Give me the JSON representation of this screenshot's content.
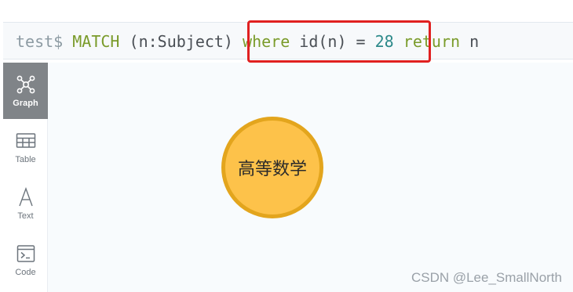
{
  "query": {
    "prompt": "test$",
    "tokens": [
      {
        "text": "MATCH",
        "kind": "keyword"
      },
      {
        "text": " (n:Subject) ",
        "kind": "plain"
      },
      {
        "text": "where",
        "kind": "keyword"
      },
      {
        "text": " id(n) ",
        "kind": "plain"
      },
      {
        "text": "=",
        "kind": "op"
      },
      {
        "text": " ",
        "kind": "plain"
      },
      {
        "text": "28",
        "kind": "num"
      },
      {
        "text": " ",
        "kind": "plain"
      },
      {
        "text": "return",
        "kind": "keyword"
      },
      {
        "text": " n",
        "kind": "plain"
      }
    ]
  },
  "annotation": {
    "highlight_color": "#e02020",
    "highlighted_text": "where id(n) = 28"
  },
  "sidebar": {
    "items": [
      {
        "label": "Graph",
        "icon": "graph-icon",
        "active": true
      },
      {
        "label": "Table",
        "icon": "table-icon",
        "active": false
      },
      {
        "label": "Text",
        "icon": "text-icon",
        "active": false
      },
      {
        "label": "Code",
        "icon": "code-icon",
        "active": false
      }
    ]
  },
  "graph": {
    "nodes": [
      {
        "caption": "高等数学",
        "fill": "#fdc24a",
        "stroke": "#e3a51d"
      }
    ]
  },
  "watermark": "CSDN @Lee_SmallNorth"
}
